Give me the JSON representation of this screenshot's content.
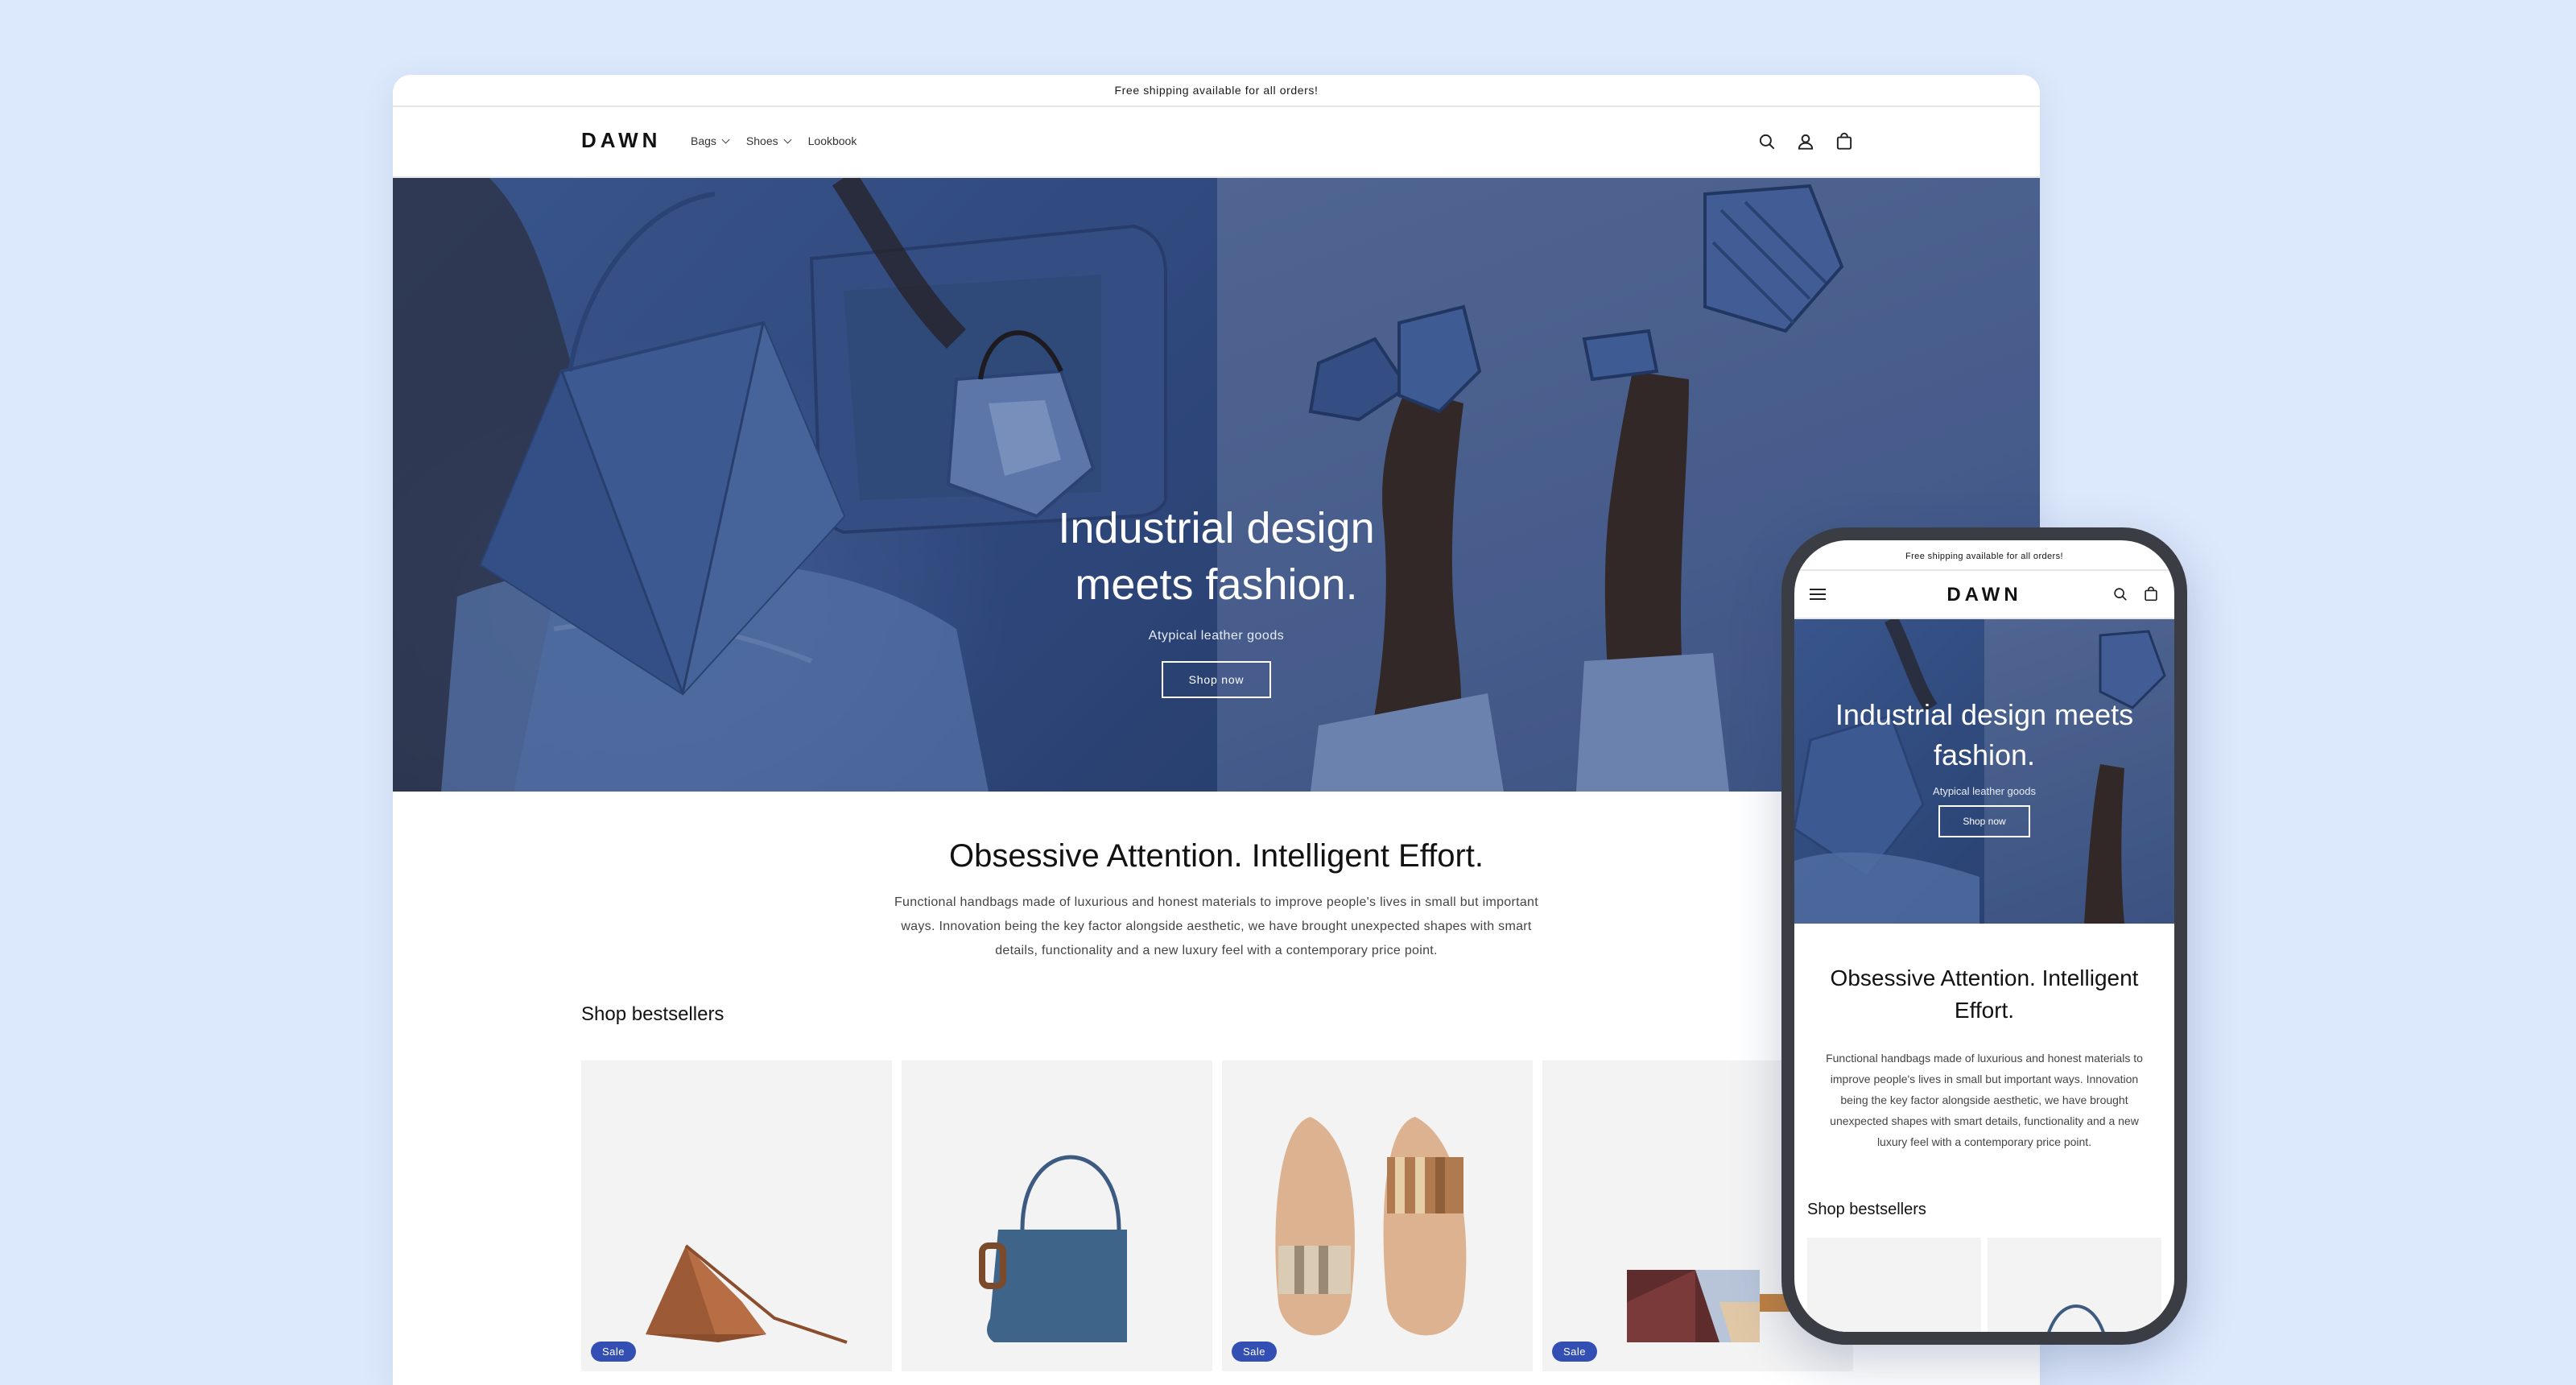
{
  "colors": {
    "page_background": "#dce8fb",
    "sale_badge": "#334fb4",
    "hero_blue": "#3f5d94"
  },
  "desktop": {
    "announcement": "Free shipping available for all orders!",
    "logo": "DAWN",
    "nav": [
      {
        "label": "Bags",
        "has_dropdown": true
      },
      {
        "label": "Shoes",
        "has_dropdown": true
      },
      {
        "label": "Lookbook",
        "has_dropdown": false
      }
    ],
    "header_icons": [
      "search-icon",
      "account-icon",
      "cart-icon"
    ],
    "hero": {
      "title": "Industrial design meets fashion.",
      "subtitle": "Atypical leather goods",
      "button": "Shop now"
    },
    "rich_text": {
      "title": "Obsessive Attention. Intelligent Effort.",
      "body": "Functional handbags made of luxurious and honest materials to improve people's lives in small but important ways. Innovation being the key factor alongside aesthetic, we have brought unexpected shapes with smart details, functionality and a new luxury feel with a contemporary price point."
    },
    "bestsellers": {
      "title": "Shop bestsellers",
      "products": [
        {
          "image": "triangular-crossbody-bag",
          "badge": "Sale"
        },
        {
          "image": "blue-shoulder-bag",
          "badge": ""
        },
        {
          "image": "pleated-slide-sandals",
          "badge": "Sale"
        },
        {
          "image": "color-block-belt-bag",
          "badge": "Sale"
        }
      ]
    }
  },
  "mobile": {
    "announcement": "Free shipping available for all orders!",
    "logo": "DAWN",
    "header_icons": [
      "menu-icon",
      "search-icon",
      "cart-icon"
    ],
    "hero": {
      "title": "Industrial design meets fashion.",
      "subtitle": "Atypical leather goods",
      "button": "Shop now"
    },
    "rich_text": {
      "title": "Obsessive Attention. Intelligent Effort.",
      "body": "Functional handbags made of luxurious and honest materials to improve people's lives in small but important ways. Innovation being the key factor alongside aesthetic, we have brought unexpected shapes with smart details, functionality and a new luxury feel with a contemporary price point."
    },
    "bestsellers_title": "Shop bestsellers"
  }
}
